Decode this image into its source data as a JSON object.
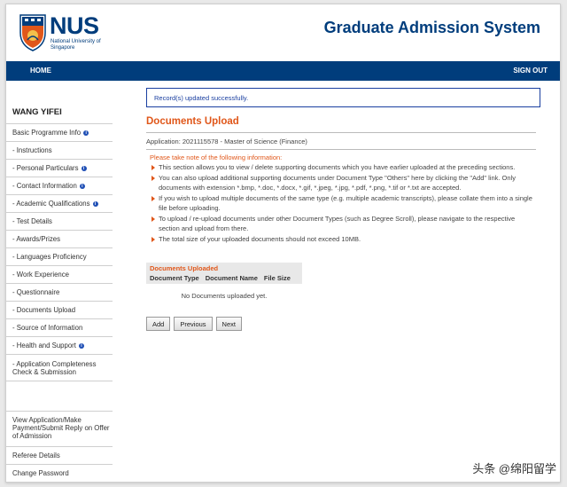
{
  "header": {
    "logo_text": "NUS",
    "logo_subtitle": "National University of Singapore",
    "system_title": "Graduate Admission System"
  },
  "nav": {
    "home": "HOME",
    "signout": "SIGN OUT"
  },
  "sidebar": {
    "user": "WANG YIFEI",
    "items": [
      {
        "label": "Basic Programme Info",
        "info": true
      },
      {
        "label": "- Instructions",
        "info": false
      },
      {
        "label": "- Personal Particulars",
        "info": true
      },
      {
        "label": "- Contact Information",
        "info": true
      },
      {
        "label": "- Academic Qualifications",
        "info": true
      },
      {
        "label": "- Test Details",
        "info": false
      },
      {
        "label": "- Awards/Prizes",
        "info": false
      },
      {
        "label": "- Languages Proficiency",
        "info": false
      },
      {
        "label": "- Work Experience",
        "info": false
      },
      {
        "label": "- Questionnaire",
        "info": false
      },
      {
        "label": "- Documents Upload",
        "info": false
      },
      {
        "label": "- Source of Information",
        "info": false
      },
      {
        "label": "- Health and Support",
        "info": true
      },
      {
        "label": "- Application Completeness Check & Submission",
        "info": false
      }
    ],
    "bottom_items": [
      "View Application/Make Payment/Submit Reply on Offer of Admission",
      "Referee Details",
      "Change Password"
    ]
  },
  "main": {
    "success_msg": "Record(s) updated successfully.",
    "title": "Documents Upload",
    "application": "Application: 2021115578 - Master of Science (Finance)",
    "notes_heading": "Please take note of the following information:",
    "notes": [
      "This section allows you to view / delete supporting documents which you have earlier uploaded at the preceding sections.",
      "You can also upload additional supporting documents under Document Type \"Others\" here by clicking the \"Add\" link. Only documents with extension *.bmp, *.doc, *.docx, *.gif, *.jpeg, *.jpg, *.pdf, *.png, *.tif or *.txt are accepted.",
      "If you wish to upload multiple documents of the same type (e.g. multiple academic transcripts), please collate them into a single file before uploading.",
      "To upload / re-upload documents under other Document Types (such as Degree Scroll), please navigate to the respective section and upload from there.",
      "The total size of your uploaded documents should not exceed 10MB."
    ],
    "docs": {
      "title": "Documents Uploaded",
      "columns": [
        "Document Type",
        "Document Name",
        "File Size"
      ],
      "empty": "No Documents uploaded yet."
    },
    "buttons": {
      "add": "Add",
      "previous": "Previous",
      "next": "Next"
    }
  },
  "watermark": "头条 @绵阳留学",
  "colors": {
    "brand_blue": "#003d7c",
    "accent_orange": "#e0571a"
  }
}
